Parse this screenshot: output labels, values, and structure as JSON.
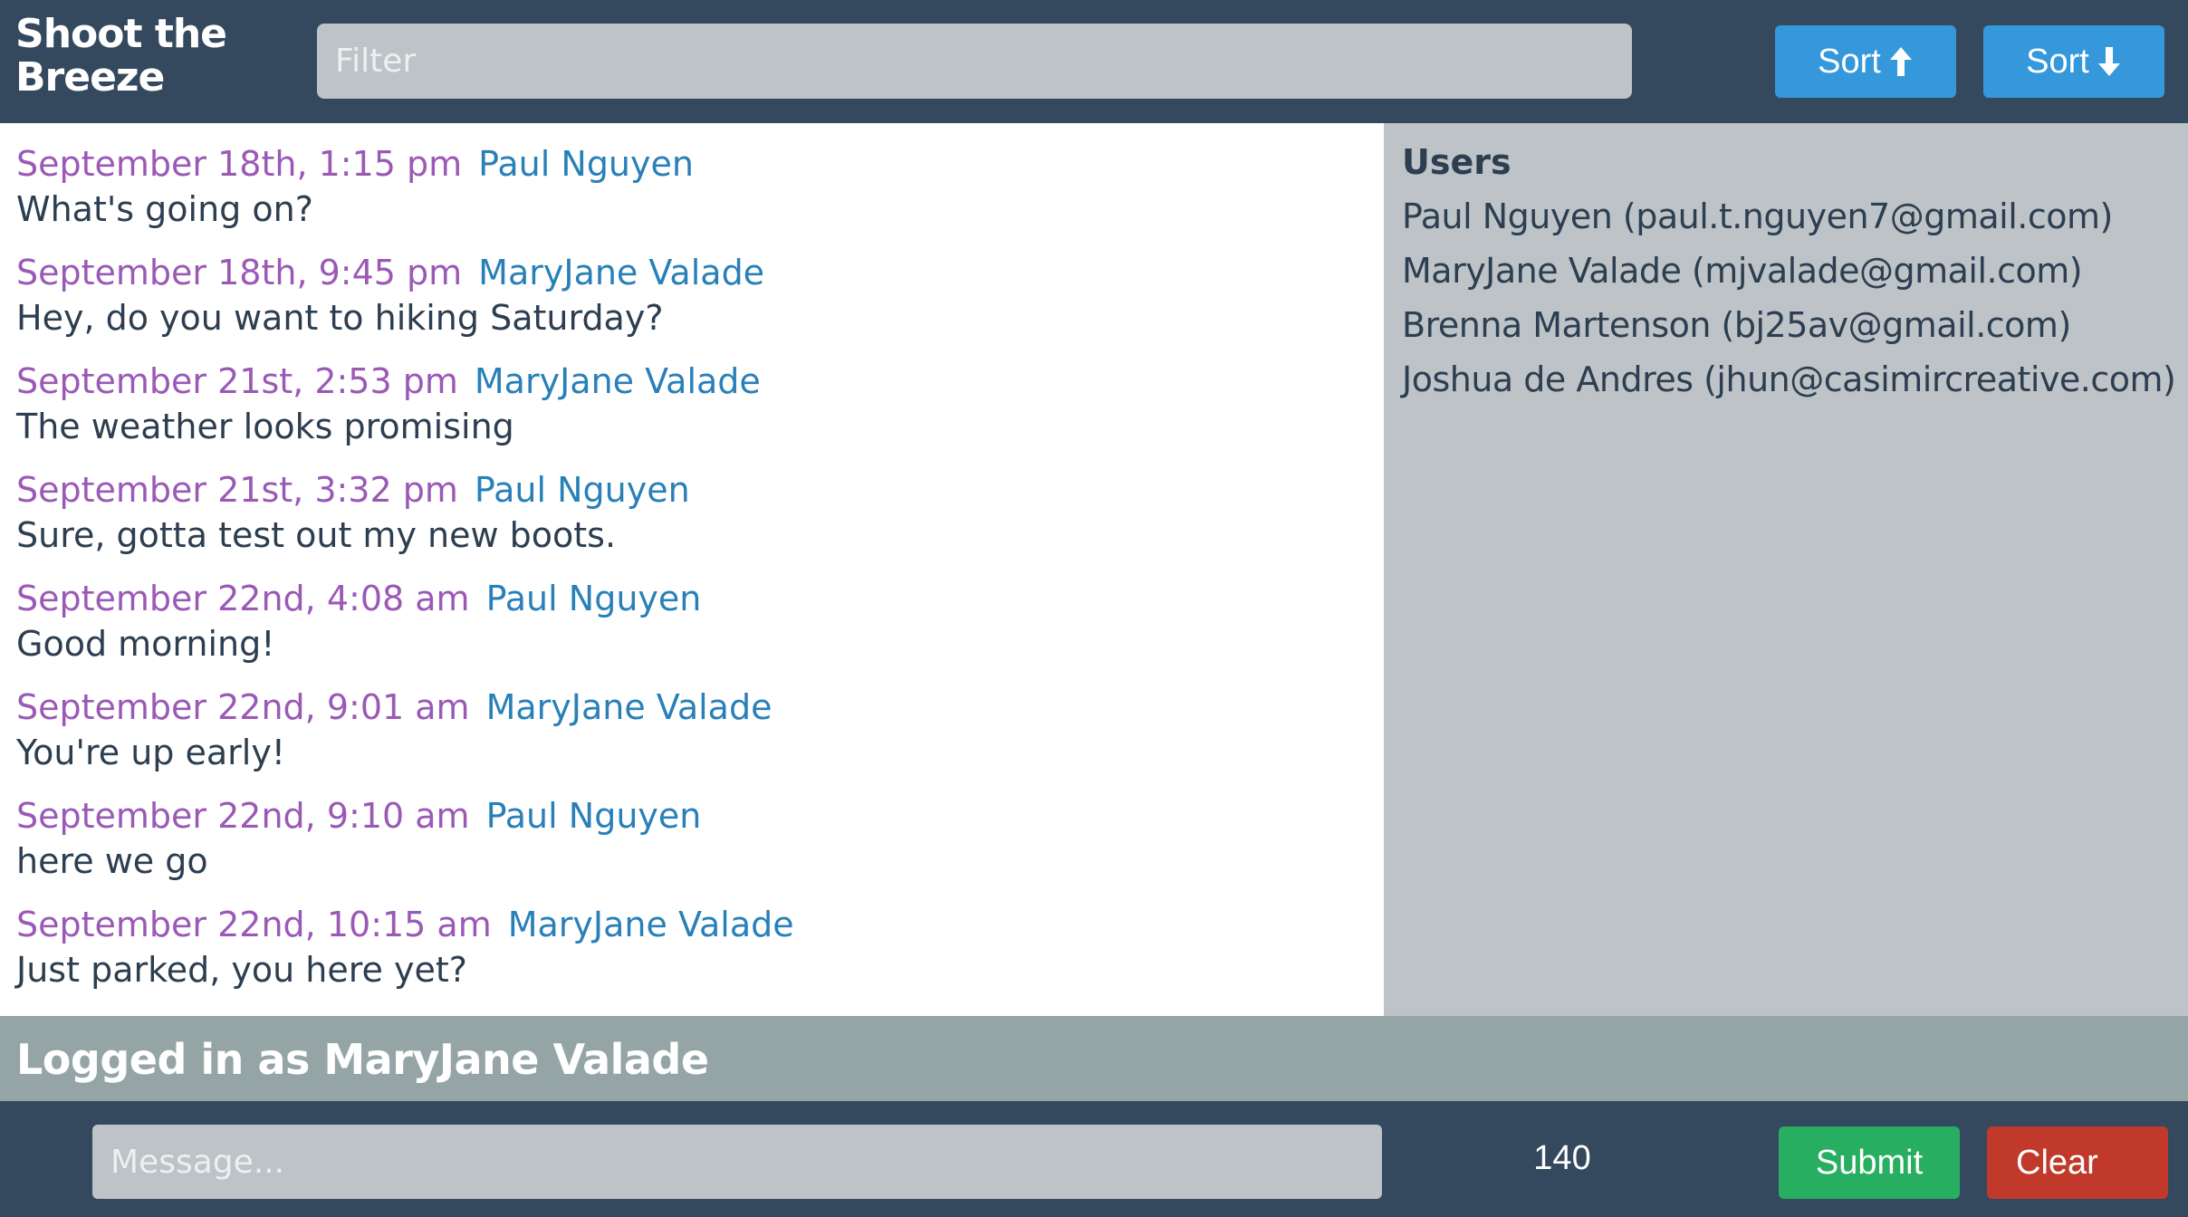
{
  "header": {
    "title": "Shoot the Breeze",
    "filter_placeholder": "Filter",
    "filter_value": "",
    "sort_asc_label": "Sort",
    "sort_asc_icon": "arrow-up-icon",
    "sort_desc_label": "Sort",
    "sort_desc_icon": "arrow-down-icon"
  },
  "messages": [
    {
      "timestamp": "September 18th, 1:15 pm",
      "author": "Paul Nguyen",
      "text": "What's going on?"
    },
    {
      "timestamp": "September 18th, 9:45 pm",
      "author": "MaryJane Valade",
      "text": "Hey, do you want to hiking Saturday?"
    },
    {
      "timestamp": "September 21st, 2:53 pm",
      "author": "MaryJane Valade",
      "text": "The weather looks promising"
    },
    {
      "timestamp": "September 21st, 3:32 pm",
      "author": "Paul Nguyen",
      "text": "Sure, gotta test out my new boots."
    },
    {
      "timestamp": "September 22nd, 4:08 am",
      "author": "Paul Nguyen",
      "text": "Good morning!"
    },
    {
      "timestamp": "September 22nd, 9:01 am",
      "author": "MaryJane Valade",
      "text": "You're up early!"
    },
    {
      "timestamp": "September 22nd, 9:10 am",
      "author": "Paul Nguyen",
      "text": "here we go"
    },
    {
      "timestamp": "September 22nd, 10:15 am",
      "author": "MaryJane Valade",
      "text": "Just parked, you here yet?"
    }
  ],
  "users": {
    "heading": "Users",
    "list": [
      "Paul Nguyen (paul.t.nguyen7@gmail.com)",
      "MaryJane Valade (mjvalade@gmail.com)",
      "Brenna Martenson (bj25av@gmail.com)",
      "Joshua de Andres (jhun@casimircreative.com)"
    ]
  },
  "status": {
    "logged_in_text": "Logged in as MaryJane Valade"
  },
  "footer": {
    "message_placeholder": "Message...",
    "message_value": "",
    "char_count": "140",
    "submit_label": "Submit",
    "clear_label": "Clear"
  },
  "colors": {
    "header_bg": "#34495e",
    "timestamp": "#9b59b6",
    "author": "#2980b9",
    "sidebar_bg": "#bdc3c7",
    "status_bg": "#95a5a6",
    "sort_button": "#3498db",
    "submit_button": "#27ae60",
    "clear_button": "#c0392b"
  }
}
